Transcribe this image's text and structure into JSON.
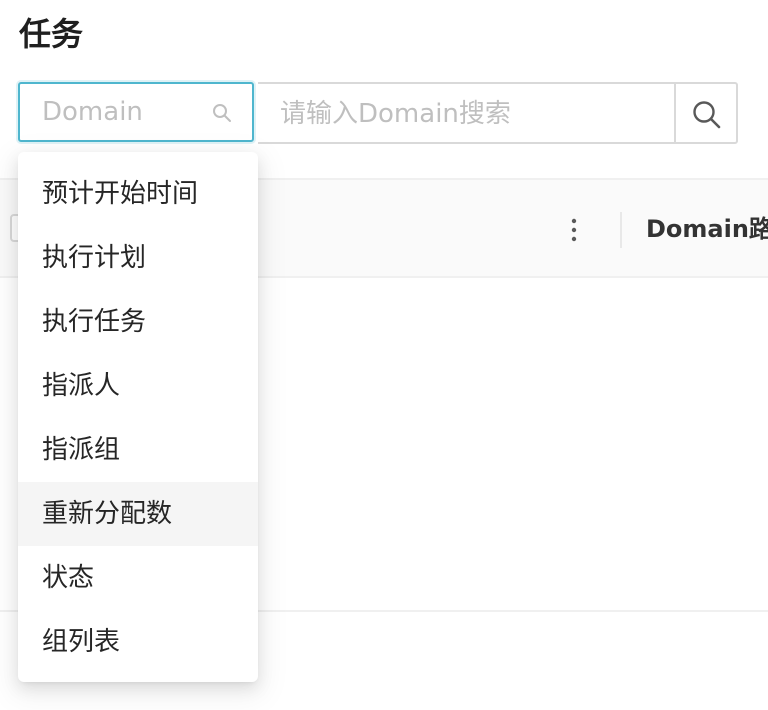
{
  "page": {
    "title": "任务"
  },
  "search": {
    "field_select": {
      "value": "Domain"
    },
    "input": {
      "placeholder": "请输入Domain搜索"
    }
  },
  "table": {
    "columns": [
      "Domain路径"
    ]
  },
  "dropdown": {
    "options": [
      "预计开始时间",
      "执行计划",
      "执行任务",
      "指派人",
      "指派组",
      "重新分配数",
      "状态",
      "组列表"
    ],
    "hovered_index": 5
  },
  "colors": {
    "focus_border": "#4fb6ce",
    "hover_bg": "#f5f5f5"
  },
  "icons": [
    "search-icon",
    "more-vertical-icon"
  ]
}
